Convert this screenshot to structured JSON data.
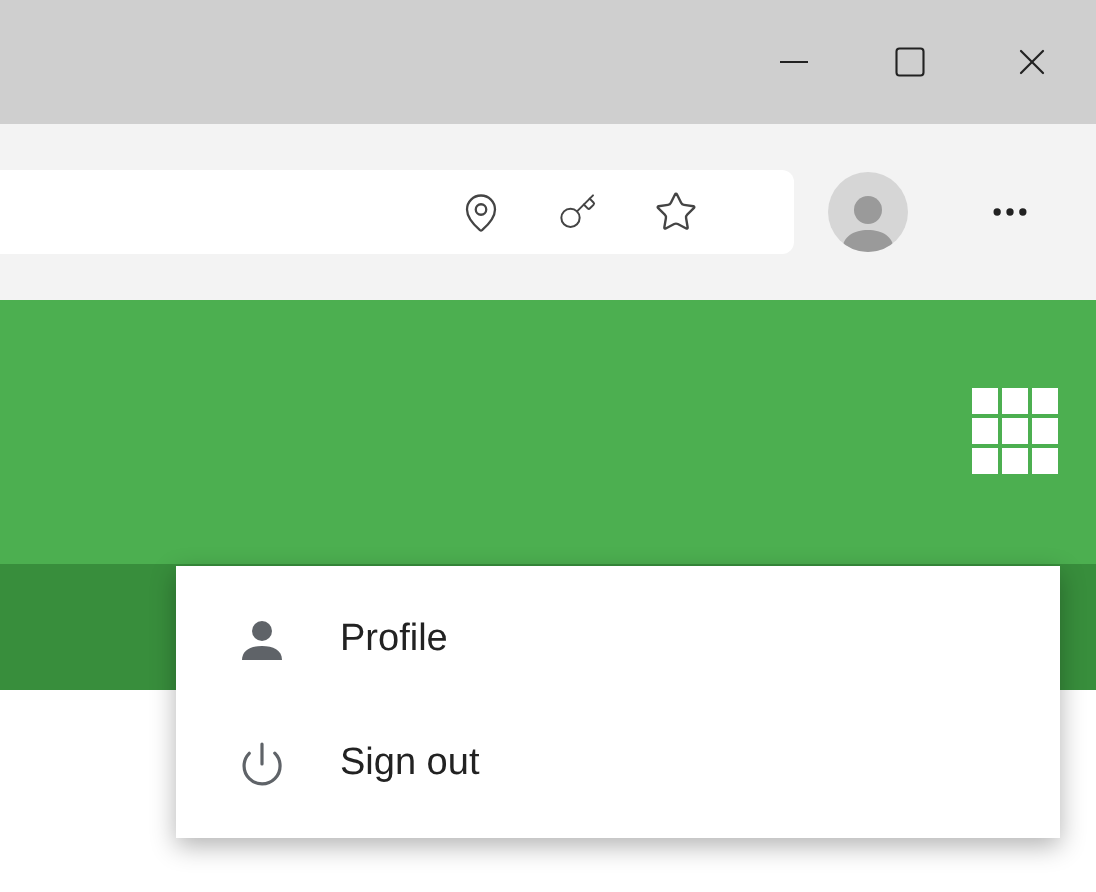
{
  "menu": {
    "items": [
      {
        "kind": "profile",
        "label": "Profile"
      },
      {
        "kind": "signout",
        "label": "Sign out"
      }
    ]
  }
}
